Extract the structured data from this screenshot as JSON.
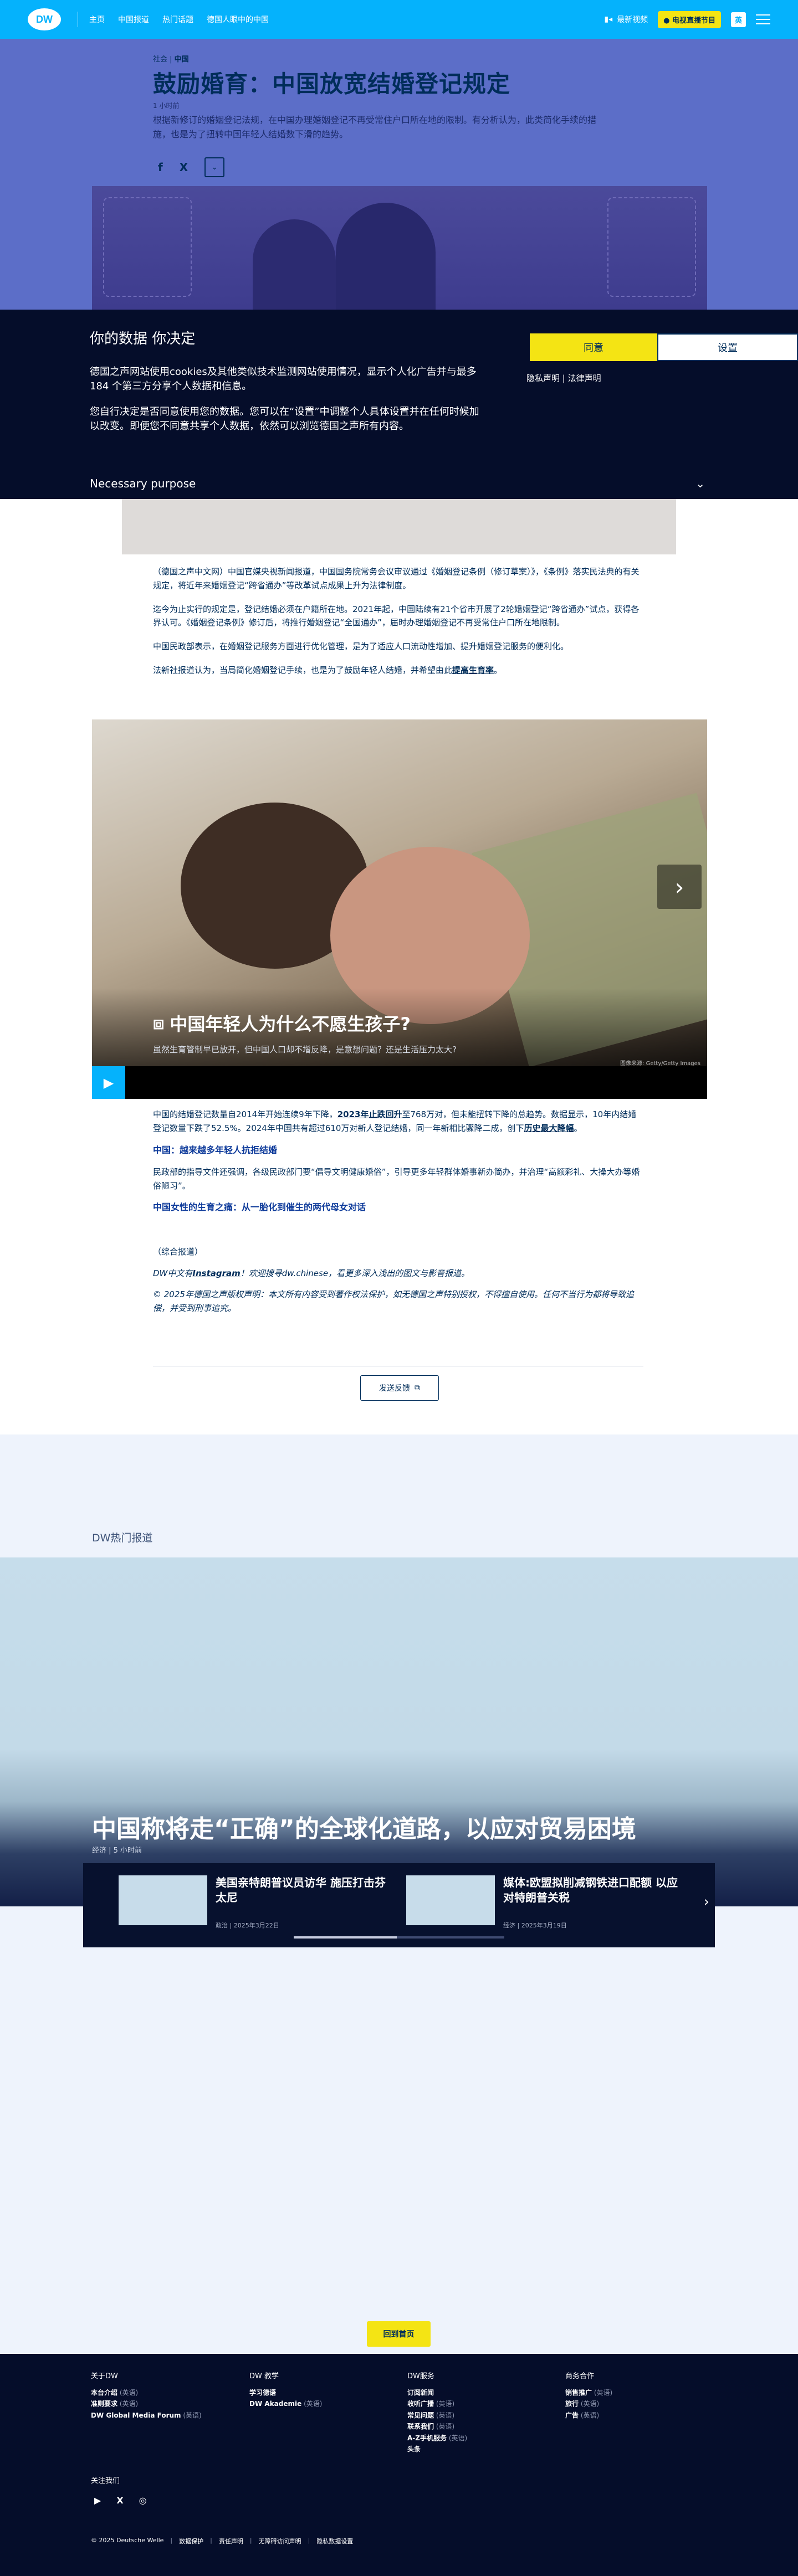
{
  "nav": {
    "logo": "DW",
    "links": [
      "主页",
      "中国报道",
      "热门话题",
      "德国人眼中的中国"
    ],
    "latest_video": "最新视频",
    "live_button": "● 电视直播节目",
    "lang_button": "英"
  },
  "article_head": {
    "breadcrumb_section": "社会",
    "breadcrumb_region": "中国",
    "headline": "鼓励婚育：中国放宽结婚登记规定",
    "timestamp": "1 小时前",
    "lede": "根据新修订的婚姻登记法规，在中国办理婚姻登记不再受常住户口所在地的限制。有分析认为，此类简化手续的措施，也是为了扭转中国年轻人结婚数下滑的趋势。",
    "share": {
      "facebook": "f",
      "x": "X",
      "more": "⌄"
    }
  },
  "cookie": {
    "title": "你的数据 你决定",
    "p1": "德国之声网站使用cookies及其他类似技术监测网站使用情况，显示个人化广告并与最多184 个第三方分享个人数据和信息。",
    "p2": "您自行决定是否同意使用您的数据。您可以在“设置”中调整个人具体设置并在任何时候加以改变。即便您不同意共享个人数据，依然可以浏览德国之声所有内容。",
    "accept": "同意",
    "settings": "设置",
    "privacy": "隐私声明",
    "legal": "法律声明",
    "purpose": "Necessary purpose",
    "purpose_icon": "⌄"
  },
  "article": {
    "p1": "（德国之声中文网）中国官媒央视新闻报道，中国国务院常务会议审议通过《婚姻登记条例（修订草案）》，《条例》落实民法典的有关规定，将近年来婚姻登记“跨省通办”等改革试点成果上升为法律制度。",
    "p2": "迄今为止实行的规定是，登记结婚必须在户籍所在地。2021年起，中国陆续有21个省市开展了2轮婚姻登记“跨省通办”试点，获得各界认可。《婚姻登记条例》修订后，将推行婚姻登记“全国通办”，届时办理婚姻登记不再受常住户口所在地限制。",
    "p3": "中国民政部表示，在婚姻登记服务方面进行优化管理，是为了适应人口流动性增加、提升婚姻登记服务的便利化。",
    "p4_prefix": "法新社报道认为，当局简化婚姻登记手续，也是为了鼓励年轻人结婚，并希望由此",
    "p4_link": "提高生育率",
    "p4_suffix": "。"
  },
  "video": {
    "title": "中国年轻人为什么不愿生孩子?",
    "subtitle": "虽然生育管制早已放开，但中国人口却不增反降，是意想问题？还是生活压力太大?",
    "credit": "图像来源: Getty/Getty Images",
    "play_icon": "▶",
    "next_icon": "›"
  },
  "article2": {
    "p1_prefix": "中国的结婚登记数量自2014年开始连续9年下降，",
    "p1_link1": "2023年止跌回升",
    "p1_mid": "至768万对，但未能扭转下降的总趋势。数据显示，10年内结婚登记数量下跌了52.5%。2024年中国共有超过610万对新人登记结婚，同一年新相比骤降二成，创下",
    "p1_link2": "历史最大降幅",
    "p1_suffix": "。",
    "sub1": "中国：越来越多年轻人抗拒结婚",
    "p2": "民政部的指导文件还强调，各级民政部门要“倡导文明健康婚俗”，引导更多年轻群体婚事新办简办，并治理“高额彩礼、大操大办等婚俗陋习”。",
    "sub2": "中国女性的生育之痛：从一胎化到催生的两代母女对话",
    "source": "（综合报道）",
    "insta_prefix": "DW中文有",
    "insta_link": "Instagram",
    "insta_suffix": "！欢迎搜寻dw.chinese，看更多深入浅出的图文与影音报道。",
    "copyright": "© 2025年德国之声版权声明：本文所有内容受到著作权法保护，如无德国之声特别授权，不得擅自使用。任何不当行为都将导致追偿，并受到刑事追究。",
    "feedback": "发送反馈",
    "feedback_icon": "⧉"
  },
  "trending": {
    "label": "DW热门报道",
    "hero_title": "中国称将走“正确”的全球化道路，以应对贸易困境",
    "hero_meta": "经济 | 5 小时前",
    "cards": [
      {
        "title": "美国亲特朗普议员访华 施压打击芬太尼",
        "meta": "政治 | 2025年3月22日"
      },
      {
        "title": "媒体:欧盟拟削减钢铁进口配额 以应对特朗普关税",
        "meta": "经济 | 2025年3月19日"
      }
    ],
    "next_icon": "›",
    "progress": 0.49
  },
  "back_top": "回到首页",
  "footer": {
    "col1": {
      "title": "关于DW",
      "items": [
        {
          "name": "本台介绍",
          "lang": "(英语)"
        },
        {
          "name": "准则要求",
          "lang": "(英语)"
        },
        {
          "name": "DW Global Media Forum",
          "lang": "(英语)"
        }
      ]
    },
    "col2": {
      "title": "DW 教学",
      "items": [
        {
          "name": "学习德语",
          "lang": ""
        },
        {
          "name": "DW Akademie",
          "lang": "(英语)"
        }
      ]
    },
    "col3": {
      "title": "DW服务",
      "items": [
        {
          "name": "订阅新闻",
          "lang": ""
        },
        {
          "name": "收听广播",
          "lang": "(英语)"
        },
        {
          "name": "常见问题",
          "lang": "(英语)"
        },
        {
          "name": "联系我们",
          "lang": "(英语)"
        },
        {
          "name": "A-Z手机服务",
          "lang": "(英语)"
        },
        {
          "name": "头条",
          "lang": ""
        }
      ]
    },
    "col4": {
      "title": "商务合作",
      "items": [
        {
          "name": "销售推广",
          "lang": "(英语)"
        },
        {
          "name": "旅行",
          "lang": "(英语)"
        },
        {
          "name": "广告",
          "lang": "(英语)"
        }
      ]
    },
    "follow": "关注我们",
    "social": [
      "▶",
      "X",
      "◎"
    ],
    "legal": [
      "© 2025 Deutsche Welle",
      "数据保护",
      "责任声明",
      "无障碍访问声明",
      "隐私数据设置"
    ]
  }
}
